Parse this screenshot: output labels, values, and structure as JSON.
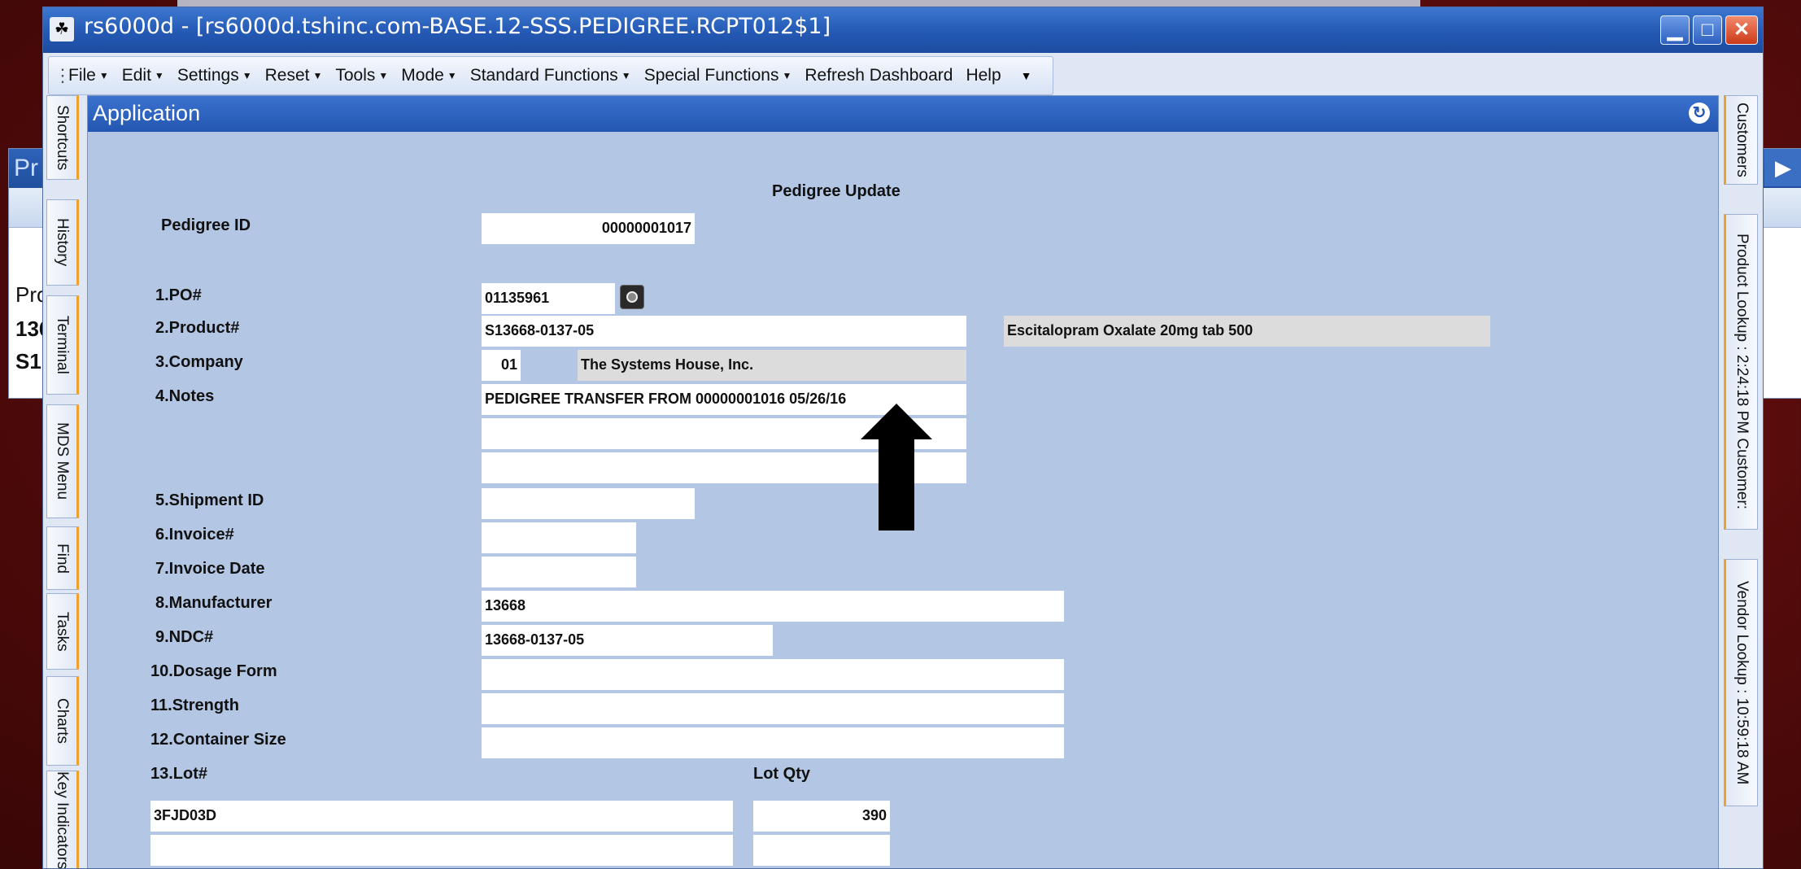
{
  "window": {
    "title": "rs6000d - [rs6000d.tshinc.com-BASE.12-SSS.PEDIGREE.RCPT012$1]",
    "app_icon": "mds-icon"
  },
  "background_window": {
    "title_fragment": "Pr",
    "row_fragments": [
      "Pro",
      "136",
      "S1"
    ]
  },
  "menubar": {
    "items": [
      {
        "label": "File",
        "dropdown": true
      },
      {
        "label": "Edit",
        "dropdown": true
      },
      {
        "label": "Settings",
        "dropdown": true
      },
      {
        "label": "Reset",
        "dropdown": true
      },
      {
        "label": "Tools",
        "dropdown": true
      },
      {
        "label": "Mode",
        "dropdown": true
      },
      {
        "label": "Standard Functions",
        "dropdown": true
      },
      {
        "label": "Special Functions",
        "dropdown": true
      },
      {
        "label": "Refresh Dashboard",
        "dropdown": false
      },
      {
        "label": "Help",
        "dropdown": false
      }
    ]
  },
  "left_tabs": [
    "Shortcuts",
    "History",
    "Terminal",
    "MDS Menu",
    "Find",
    "Tasks",
    "Charts",
    "Key Indicators"
  ],
  "right_tabs": [
    "Customers",
    "Product Lookup : 2:24:18 PM Customer:",
    "Vendor Lookup : 10:59:18 AM"
  ],
  "app": {
    "header": "Application",
    "form_title": "Pedigree Update",
    "pedigree_id_label": "Pedigree ID",
    "pedigree_id_value": "00000001017",
    "fields": {
      "po_label": "1.PO#",
      "po_value": "01135961",
      "product_label": "2.Product#",
      "product_value": "S13668-0137-05",
      "product_desc": "Escitalopram Oxalate 20mg tab 500",
      "company_label": "3.Company",
      "company_code": "01",
      "company_name": "The Systems House, Inc.",
      "notes_label": "4.Notes",
      "notes_line1": "PEDIGREE TRANSFER FROM 00000001016 05/26/16",
      "notes_line2": "",
      "notes_line3": "",
      "shipment_label": "5.Shipment ID",
      "shipment_value": "",
      "invoice_label": "6.Invoice#",
      "invoice_value": "",
      "invoice_date_label": "7.Invoice Date",
      "invoice_date_value": "",
      "manufacturer_label": "8.Manufacturer",
      "manufacturer_value": "13668",
      "ndc_label": "9.NDC#",
      "ndc_value": "13668-0137-05",
      "dosage_label": "10.Dosage Form",
      "dosage_value": "",
      "strength_label": "11.Strength",
      "strength_value": "",
      "container_label": "12.Container Size",
      "container_value": "",
      "lot_label": "13.Lot#",
      "lot_qty_label": "Lot Qty",
      "lots": [
        {
          "lot": "3FJD03D",
          "qty": "390"
        },
        {
          "lot": "",
          "qty": ""
        },
        {
          "lot": "",
          "qty": ""
        }
      ]
    }
  },
  "colors": {
    "desktop": "#5a0c0c",
    "title_bar": "#2459b4",
    "panel_bg": "#b3c6e3",
    "tab_accent": "#f0a030"
  }
}
